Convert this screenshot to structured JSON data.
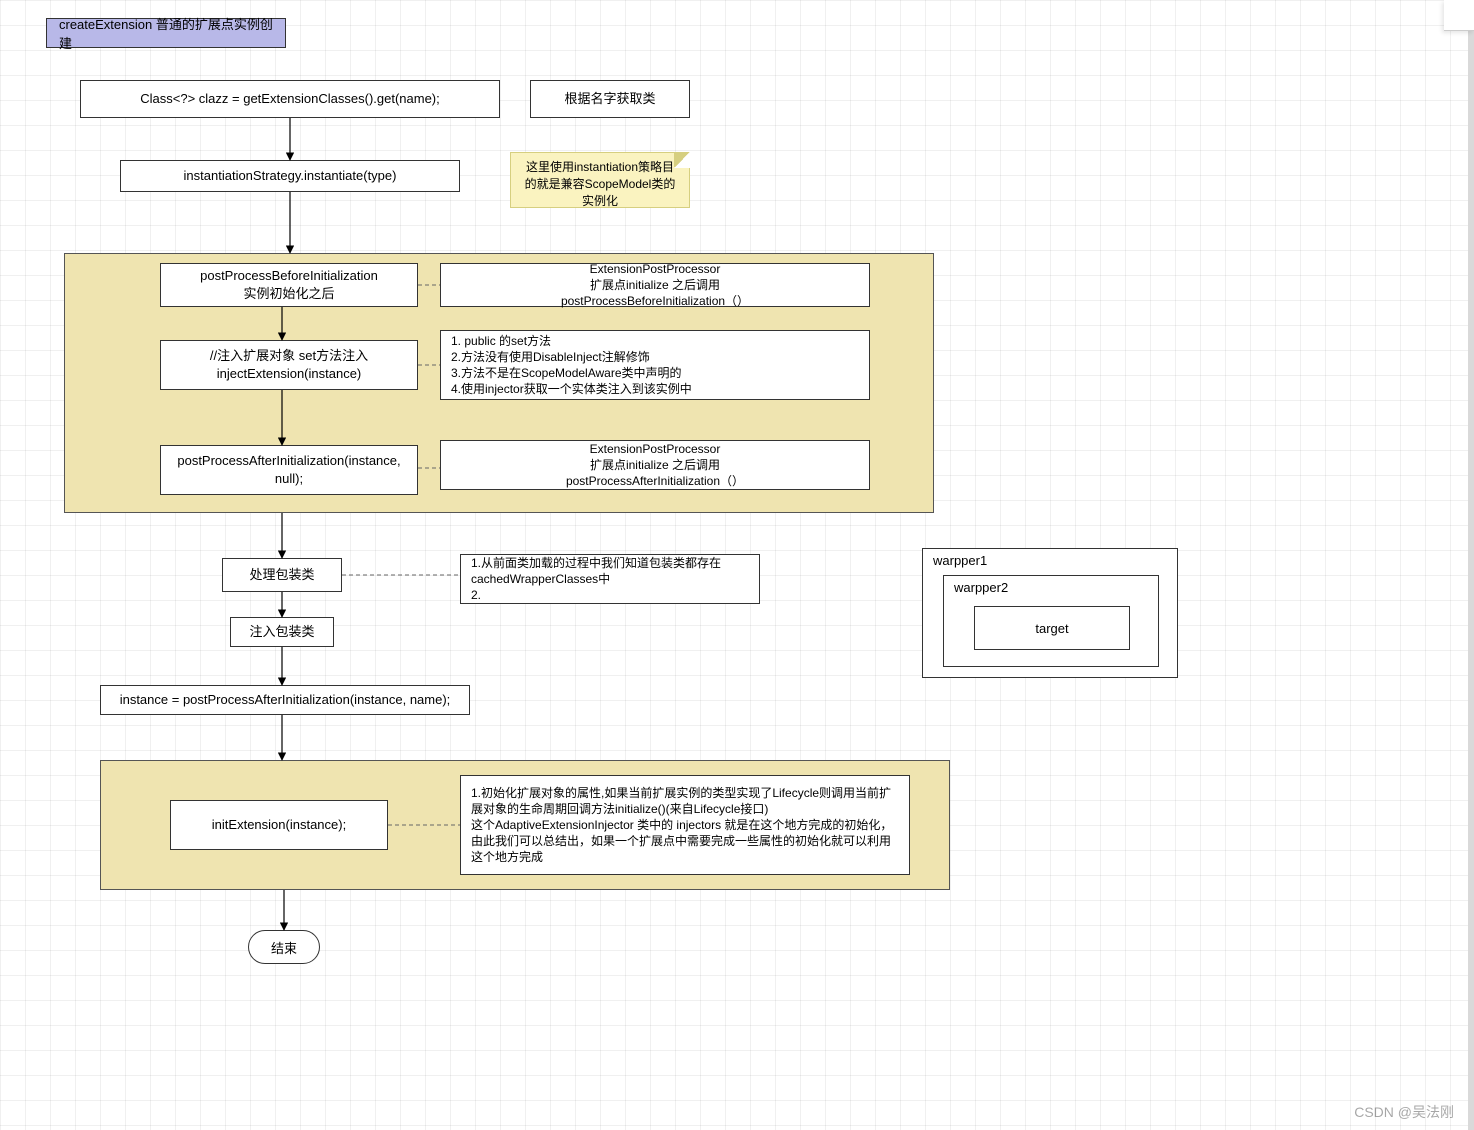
{
  "title": "createExtension 普通的扩展点实例创建",
  "step1": "Class<?> clazz = getExtensionClasses().get(name);",
  "note1": "根据名字获取类",
  "step2": "instantiationStrategy.instantiate(type)",
  "note2": "这里使用instantiation策略目的就是兼容ScopeModel类的实例化",
  "region1": {
    "before": {
      "left": "postProcessBeforeInitialization\n实例初始化之后",
      "right": "ExtensionPostProcessor\n扩展点initialize 之后调用\npostProcessBeforeInitialization（）"
    },
    "inject": {
      "left": "//注入扩展对象 set方法注入\ninjectExtension(instance)",
      "right": "1. public 的set方法\n2.方法没有使用DisableInject注解修饰\n3.方法不是在ScopeModelAware类中声明的\n4.使用injector获取一个实体类注入到该实例中"
    },
    "after": {
      "left": "postProcessAfterInitialization(instance, null);",
      "right": "ExtensionPostProcessor\n扩展点initialize 之后调用\npostProcessAfterInitialization（）"
    }
  },
  "wrap": {
    "process": "处理包装类",
    "note": "1.从前面类加载的过程中我们知道包装类都存在cachedWrapperClasses中\n2.",
    "inject": "注入包装类"
  },
  "post2": "instance = postProcessAfterInitialization(instance, name);",
  "region2": {
    "init": "initExtension(instance);",
    "note": "1.初始化扩展对象的属性,如果当前扩展实例的类型实现了Lifecycle则调用当前扩展对象的生命周期回调方法initialize()(来自Lifecycle接口)\n这个AdaptiveExtensionInjector 类中的 injectors 就是在这个地方完成的初始化，由此我们可以总结出，如果一个扩展点中需要完成一些属性的初始化就可以利用这个地方完成"
  },
  "end": "结束",
  "wrapper": {
    "outer": "warpper1",
    "middle": "warpper2",
    "inner": "target"
  },
  "watermark": "CSDN @吴法刚"
}
